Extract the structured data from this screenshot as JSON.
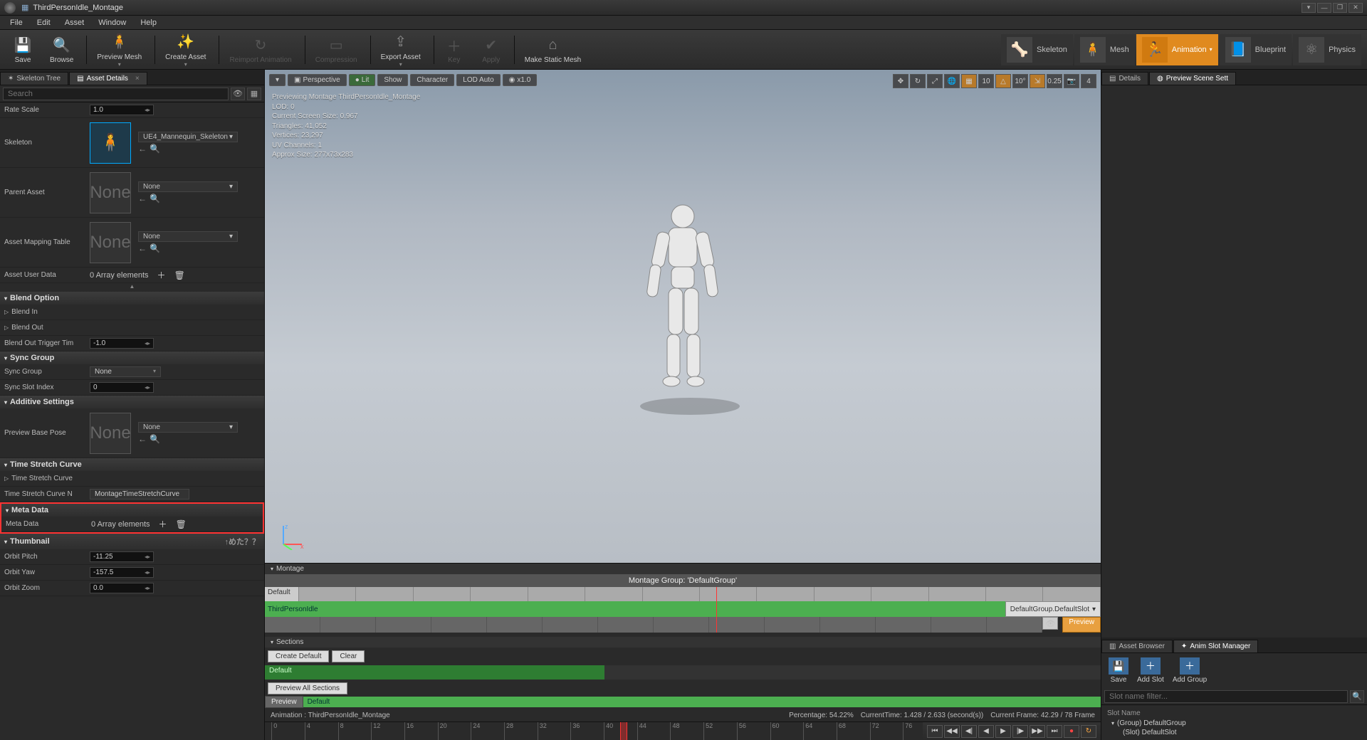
{
  "window": {
    "title": "ThirdPersonIdle_Montage"
  },
  "menu": [
    "File",
    "Edit",
    "Asset",
    "Window",
    "Help"
  ],
  "toolbar": [
    {
      "label": "Save",
      "icon": "💾"
    },
    {
      "label": "Browse",
      "icon": "🔍"
    },
    {
      "label": "Preview Mesh",
      "icon": "🧍"
    },
    {
      "label": "Create Asset",
      "icon": "✨"
    },
    {
      "label": "Reimport Animation",
      "icon": "↻",
      "disabled": true
    },
    {
      "label": "Compression",
      "icon": "▭",
      "disabled": true
    },
    {
      "label": "Export Asset",
      "icon": "⇪"
    },
    {
      "label": "Key",
      "icon": "＋",
      "disabled": true
    },
    {
      "label": "Apply",
      "icon": "✔",
      "disabled": true
    },
    {
      "label": "Make Static Mesh",
      "icon": "⌂"
    }
  ],
  "modes": [
    {
      "label": "Skeleton"
    },
    {
      "label": "Mesh"
    },
    {
      "label": "Animation",
      "active": true
    },
    {
      "label": "Blueprint"
    },
    {
      "label": "Physics"
    }
  ],
  "left_tabs": [
    {
      "label": "Skeleton Tree",
      "icon": "✶"
    },
    {
      "label": "Asset Details",
      "icon": "▤",
      "active": true
    }
  ],
  "search": {
    "placeholder": "Search"
  },
  "details": {
    "rate_scale": {
      "label": "Rate Scale",
      "value": "1.0"
    },
    "skeleton": {
      "label": "Skeleton",
      "ref": "UE4_Mannequin_Skeleton"
    },
    "parent_asset": {
      "label": "Parent Asset",
      "ref": "None"
    },
    "asset_mapping": {
      "label": "Asset Mapping Table",
      "ref": "None"
    },
    "asset_user_data": {
      "label": "Asset User Data",
      "value": "0 Array elements"
    },
    "cat_blend": "Blend Option",
    "blend_in": "Blend In",
    "blend_out": "Blend Out",
    "blend_out_trigger": {
      "label": "Blend Out Trigger Tim",
      "value": "-1.0"
    },
    "cat_sync": "Sync Group",
    "sync_group": {
      "label": "Sync Group",
      "value": "None"
    },
    "sync_slot_index": {
      "label": "Sync Slot Index",
      "value": "0"
    },
    "cat_additive": "Additive Settings",
    "preview_base_pose": {
      "label": "Preview Base Pose",
      "ref": "None"
    },
    "cat_stretch": "Time Stretch Curve",
    "time_stretch_curve": "Time Stretch Curve",
    "time_stretch_curve_n": {
      "label": "Time Stretch Curve N",
      "value": "MontageTimeStretchCurve"
    },
    "cat_meta": "Meta Data",
    "meta_data": {
      "label": "Meta Data",
      "value": "0 Array elements"
    },
    "cat_thumb": "Thumbnail",
    "orbit_pitch": {
      "label": "Orbit Pitch",
      "value": "-11.25"
    },
    "orbit_yaw": {
      "label": "Orbit Yaw",
      "value": "-157.5"
    },
    "orbit_zoom": {
      "label": "Orbit Zoom",
      "value": "0.0"
    },
    "jp_note": "↑めた？？"
  },
  "viewport": {
    "buttons": {
      "persp": "Perspective",
      "lit": "Lit",
      "show": "Show",
      "char": "Character",
      "lod": "LOD Auto",
      "speed": "x1.0"
    },
    "right_vals": {
      "grid": "10",
      "angle": "10°",
      "scale": "0.25",
      "cam": "4"
    },
    "overlay": [
      "Previewing Montage ThirdPersonIdle_Montage",
      "LOD: 0",
      "Current Screen Size: 0.967",
      "Triangles: 41,052",
      "Vertices: 23,297",
      "UV Channels: 1",
      "Approx Size: 277x73x283"
    ]
  },
  "montage": {
    "header": "Montage",
    "group_title": "Montage Group: 'DefaultGroup'",
    "default_label": "Default",
    "clip_name": "ThirdPersonIdle",
    "slot_dd": "DefaultGroup.DefaultSlot",
    "preview_btn": "Preview",
    "sections_header": "Sections",
    "create_default": "Create Default",
    "clear": "Clear",
    "section_default": "Default",
    "preview_all": "Preview All Sections",
    "preview_lbl": "Preview",
    "preview_val": "Default"
  },
  "status": {
    "anim": "Animation :  ThirdPersonIdle_Montage",
    "pct": "Percentage:  54.22%",
    "time": "CurrentTime:  1.428 / 2.633 (second(s))",
    "frame": "Current Frame:  42.29 / 78 Frame"
  },
  "ruler_ticks": [
    "0",
    "4",
    "8",
    "12",
    "16",
    "20",
    "24",
    "28",
    "32",
    "36",
    "40",
    "44",
    "48",
    "52",
    "56",
    "60",
    "64",
    "68",
    "72",
    "76"
  ],
  "right_tabs_top": [
    {
      "label": "Details",
      "icon": "▤"
    },
    {
      "label": "Preview Scene Sett",
      "icon": "◍",
      "active": true
    }
  ],
  "right_tabs_bottom": [
    {
      "label": "Asset Browser",
      "icon": "▥"
    },
    {
      "label": "Anim Slot Manager",
      "icon": "✦",
      "active": true
    }
  ],
  "asset_browser": {
    "tools": [
      {
        "label": "Save",
        "icon": "💾"
      },
      {
        "label": "Add Slot",
        "icon": "＋"
      },
      {
        "label": "Add Group",
        "icon": "＋"
      }
    ],
    "filter_placeholder": "Slot name filter...",
    "col_header": "Slot Name",
    "group": "(Group) DefaultGroup",
    "slot": "(Slot) DefaultSlot"
  }
}
